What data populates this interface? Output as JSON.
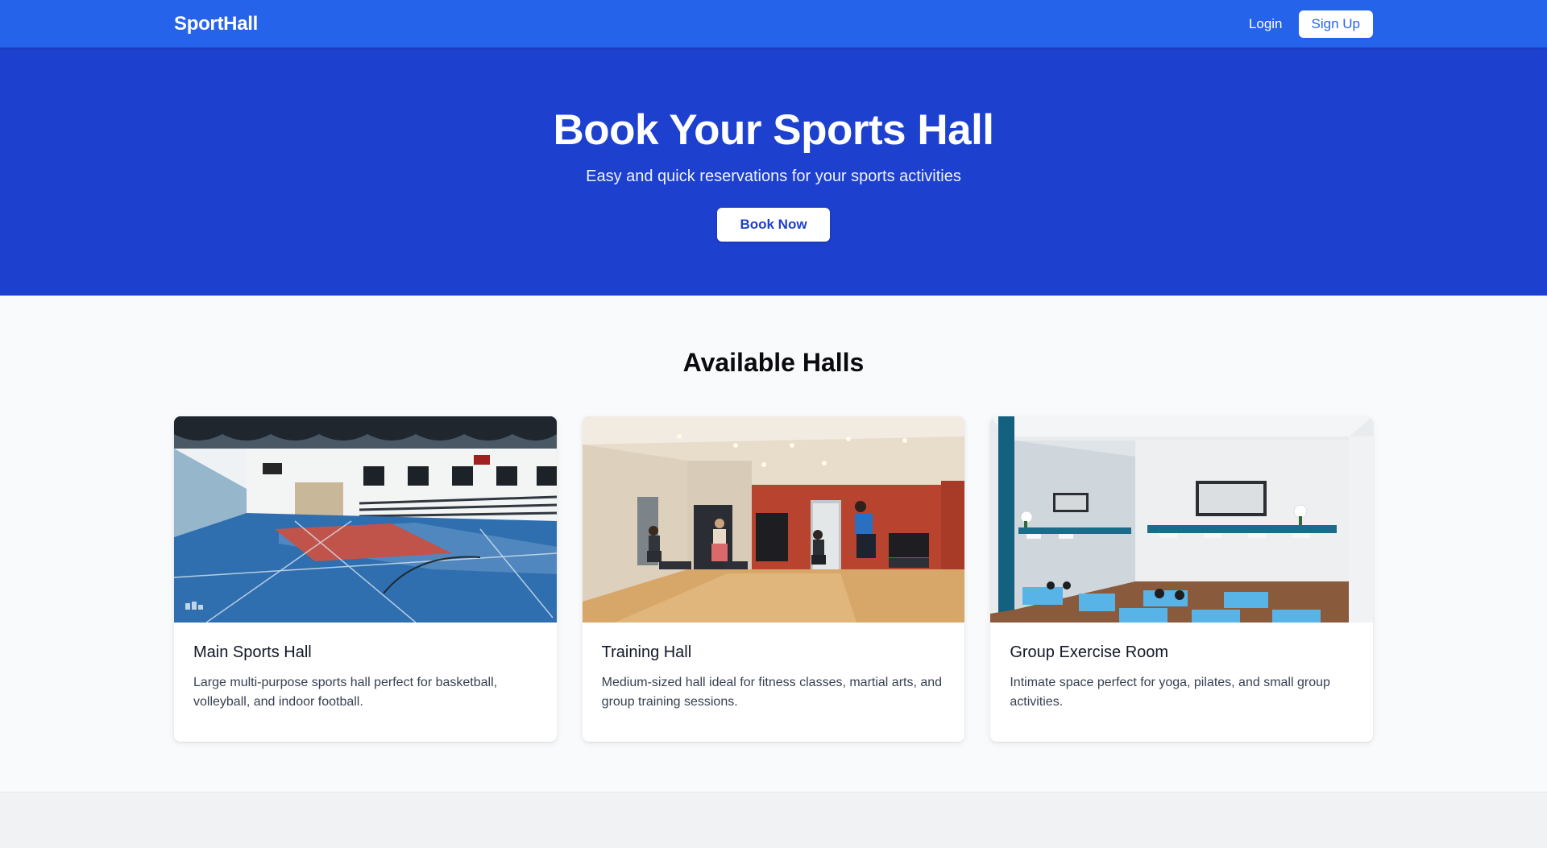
{
  "nav": {
    "brand": "SportHall",
    "login_label": "Login",
    "signup_label": "Sign Up"
  },
  "hero": {
    "title": "Book Your Sports Hall",
    "subtitle": "Easy and quick reservations for your sports activities",
    "cta_label": "Book Now"
  },
  "halls": {
    "title": "Available Halls",
    "cards": [
      {
        "title": "Main Sports Hall",
        "description": "Large multi-purpose sports hall perfect for basketball, volleyball, and indoor football."
      },
      {
        "title": "Training Hall",
        "description": "Medium-sized hall ideal for fitness classes, martial arts, and group training sessions."
      },
      {
        "title": "Group Exercise Room",
        "description": "Intimate space perfect for yoga, pilates, and small group activities."
      }
    ]
  },
  "colors": {
    "navbar": "#2563eb",
    "hero": "#1d40cf",
    "background": "#f8fafc",
    "footer": "#f1f2f4"
  }
}
